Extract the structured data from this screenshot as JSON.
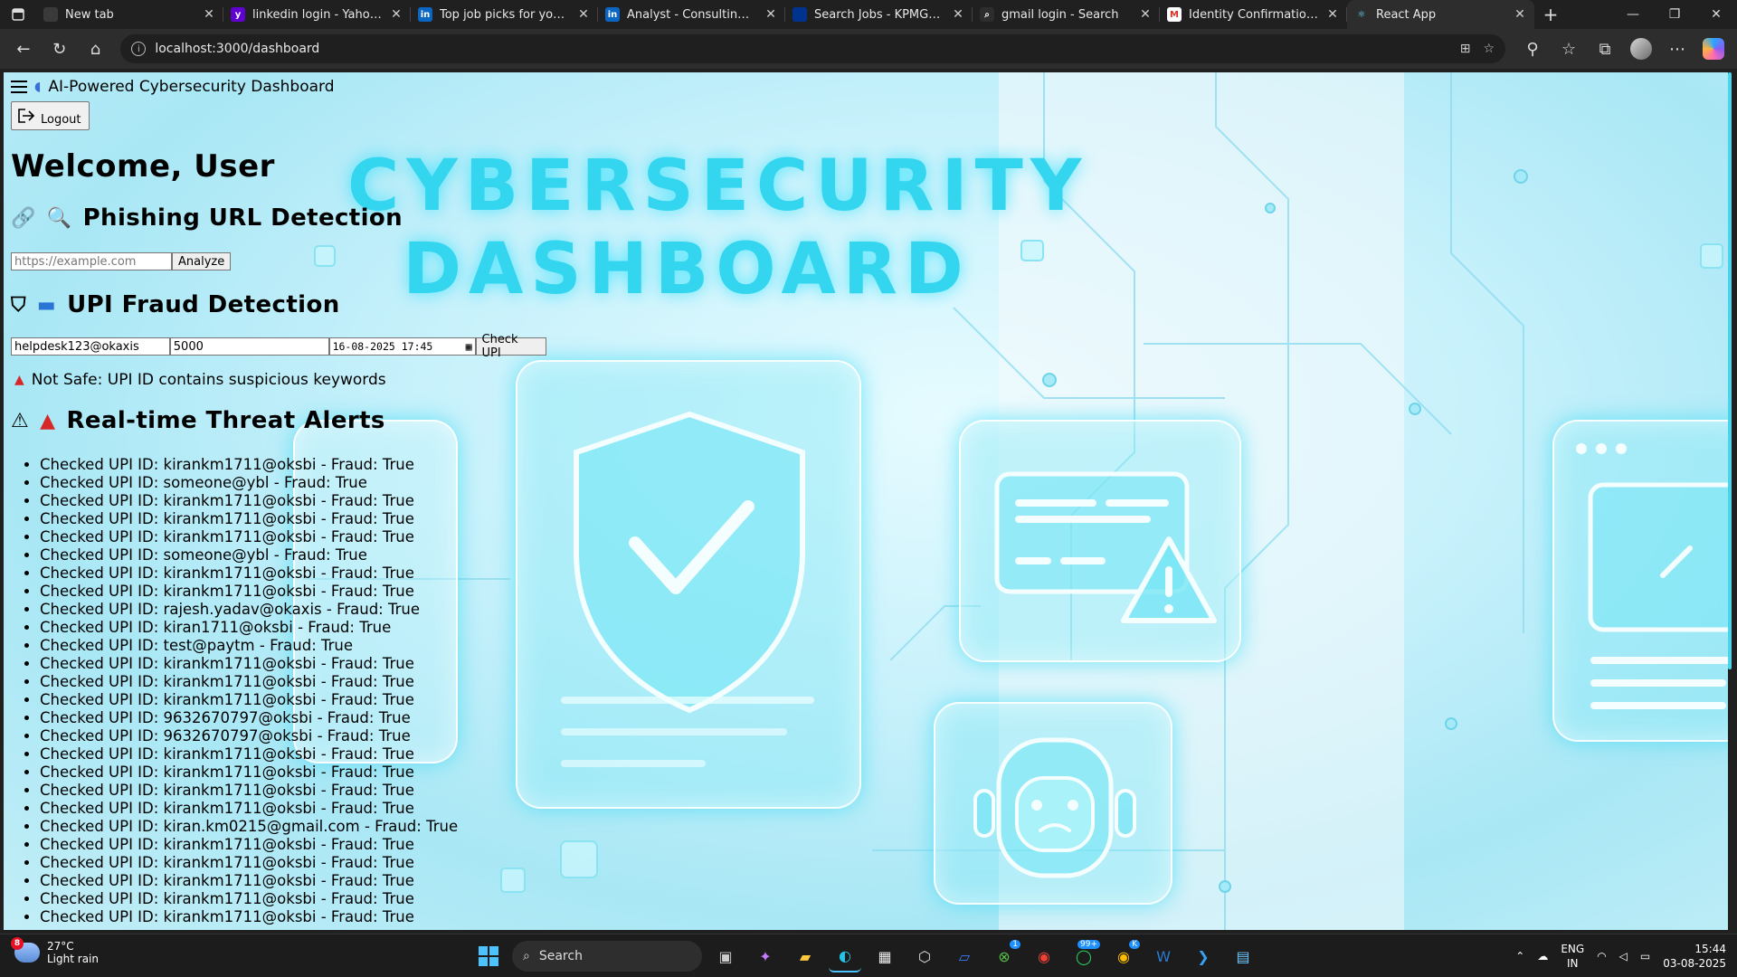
{
  "browser": {
    "tabs": [
      {
        "title": "New tab",
        "icon": "newtab-icon",
        "color": "#3a3a3a",
        "glyph": ""
      },
      {
        "title": "linkedin login - Yahoo India",
        "icon": "yahoo-icon",
        "color": "#6001d2",
        "glyph": "y"
      },
      {
        "title": "Top job picks for you | LinkedIn",
        "icon": "linkedin-icon",
        "color": "#0a66c2",
        "glyph": "in"
      },
      {
        "title": "Analyst - Consulting Implementation",
        "icon": "linkedin-icon",
        "color": "#0a66c2",
        "glyph": "in"
      },
      {
        "title": "Search Jobs - KPMG India Careers",
        "icon": "kpmg-icon",
        "color": "#00338d",
        "glyph": ""
      },
      {
        "title": "gmail login - Search",
        "icon": "bing-search-icon",
        "color": "#2d2d2d",
        "glyph": "⌕"
      },
      {
        "title": "Identity Confirmation - kiran",
        "icon": "gmail-icon",
        "color": "#ffffff",
        "glyph": "M"
      },
      {
        "title": "React App",
        "icon": "react-icon",
        "color": "#2d2d2d",
        "glyph": "⚛"
      }
    ],
    "active_tab": 7,
    "url": "localhost:3000/dashboard"
  },
  "app": {
    "header_title": "AI-Powered Cybersecurity Dashboard",
    "logout_label": "Logout",
    "welcome": "Welcome, User",
    "hero_line1": "CYBERSECURITY",
    "hero_line2": "DASHBOARD",
    "phishing": {
      "title": "Phishing URL Detection",
      "placeholder": "https://example.com",
      "button": "Analyze"
    },
    "upi": {
      "title": "UPI Fraud Detection",
      "upi_id": "helpdesk123@okaxis",
      "amount": "5000",
      "datetime": "16-08-2025 17:45",
      "button": "Check UPI",
      "result": "Not Safe: UPI ID contains suspicious keywords"
    },
    "alerts": {
      "title": "Real-time Threat Alerts",
      "items": [
        "Checked UPI ID: kirankm1711@oksbi - Fraud: True",
        "Checked UPI ID: someone@ybl - Fraud: True",
        "Checked UPI ID: kirankm1711@oksbi - Fraud: True",
        "Checked UPI ID: kirankm1711@oksbi - Fraud: True",
        "Checked UPI ID: kirankm1711@oksbi - Fraud: True",
        "Checked UPI ID: someone@ybl - Fraud: True",
        "Checked UPI ID: kirankm1711@oksbi - Fraud: True",
        "Checked UPI ID: kirankm1711@oksbi - Fraud: True",
        "Checked UPI ID: rajesh.yadav@okaxis - Fraud: True",
        "Checked UPI ID: kiran1711@oksbi - Fraud: True",
        "Checked UPI ID: test@paytm - Fraud: True",
        "Checked UPI ID: kirankm1711@oksbi - Fraud: True",
        "Checked UPI ID: kirankm1711@oksbi - Fraud: True",
        "Checked UPI ID: kirankm1711@oksbi - Fraud: True",
        "Checked UPI ID: 9632670797@oksbi - Fraud: True",
        "Checked UPI ID: 9632670797@oksbi - Fraud: True",
        "Checked UPI ID: kirankm1711@oksbi - Fraud: True",
        "Checked UPI ID: kirankm1711@oksbi - Fraud: True",
        "Checked UPI ID: kirankm1711@oksbi - Fraud: True",
        "Checked UPI ID: kirankm1711@oksbi - Fraud: True",
        "Checked UPI ID: kiran.km0215@gmail.com - Fraud: True",
        "Checked UPI ID: kirankm1711@oksbi - Fraud: True",
        "Checked UPI ID: kirankm1711@oksbi - Fraud: True",
        "Checked UPI ID: kirankm1711@oksbi - Fraud: True",
        "Checked UPI ID: kirankm1711@oksbi - Fraud: True",
        "Checked UPI ID: kirankm1711@oksbi - Fraud: True"
      ]
    }
  },
  "taskbar": {
    "weather_temp": "27°C",
    "weather_desc": "Light rain",
    "weather_badge": "8",
    "search_label": "Search",
    "lang1": "ENG",
    "lang2": "IN",
    "time": "15:44",
    "date": "03-08-2025",
    "badges": {
      "xbox": "1",
      "whatsapp": "99+",
      "chrome_profile": "K"
    }
  }
}
